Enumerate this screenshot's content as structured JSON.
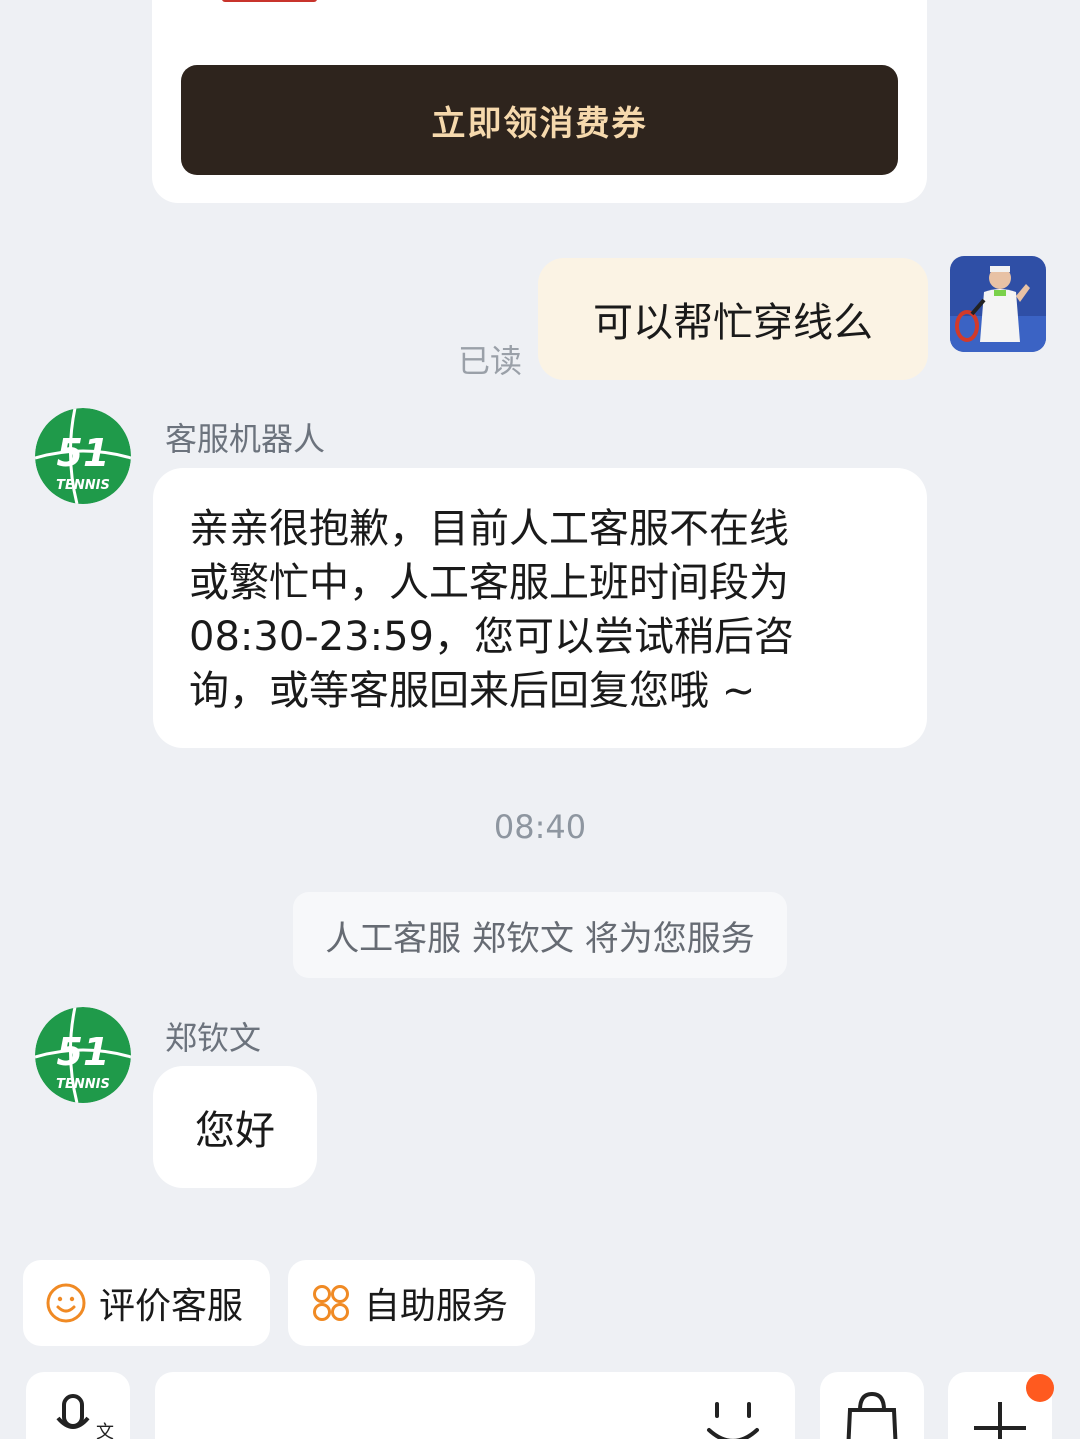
{
  "coupon": {
    "button_label": "立即领消费券"
  },
  "outgoing": {
    "text": "可以帮忙穿线么",
    "read_status": "已读"
  },
  "bot": {
    "logo_number": "51",
    "logo_word": "TENNIS",
    "name": "客服机器人",
    "message_lines": [
      "亲亲很抱歉，目前人工客服不在线",
      "或繁忙中，人工客服上班时间段为",
      "08:30-23:59，您可以尝试稍后咨",
      "询，或等客服回来后回复您哦 ~"
    ]
  },
  "timestamp": "08:40",
  "system_note": "人工客服 郑钦文 将为您服务",
  "agent": {
    "name": "郑钦文",
    "message": "您好"
  },
  "quick_actions": {
    "rate": {
      "label": "评价客服",
      "icon": "smile-icon"
    },
    "self_service": {
      "label": "自助服务",
      "icon": "grid-icon"
    }
  },
  "bottom_bar": {
    "voice_icon": "microphone-icon",
    "emoji_icon": "emoji-icon",
    "shop_icon": "shopping-bag-icon",
    "more_icon": "plus-icon"
  },
  "colors": {
    "accent_orange": "#f08a24",
    "brand_green": "#1f9a4a",
    "coupon_dark": "#2e241d",
    "coupon_text": "#f6d9ad"
  }
}
